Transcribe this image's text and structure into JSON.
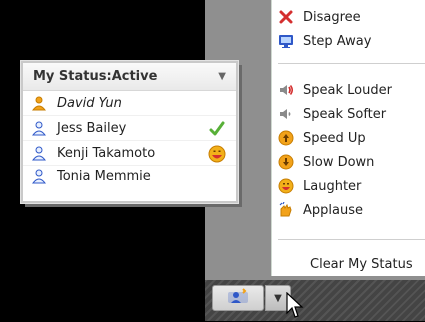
{
  "status_menu": {
    "items": [
      {
        "label": "Disagree",
        "icon": "disagree-icon"
      },
      {
        "label": "Step Away",
        "icon": "step-away-icon"
      },
      {
        "label": "Speak Louder",
        "icon": "speaker-louder-icon"
      },
      {
        "label": "Speak Softer",
        "icon": "speaker-softer-icon"
      },
      {
        "label": "Speed Up",
        "icon": "speed-up-icon"
      },
      {
        "label": "Slow Down",
        "icon": "slow-down-icon"
      },
      {
        "label": "Laughter",
        "icon": "laughter-icon"
      },
      {
        "label": "Applause",
        "icon": "applause-icon"
      },
      {
        "label": "Clear My Status",
        "icon": ""
      }
    ]
  },
  "my_status_panel": {
    "title": "My Status:Active",
    "users": [
      {
        "name": "David Yun",
        "status_icon": ""
      },
      {
        "name": "Jess Bailey",
        "status_icon": "checkmark-icon"
      },
      {
        "name": "Kenji Takamoto",
        "status_icon": "laughter-icon"
      },
      {
        "name": "Tonia Memmie",
        "status_icon": ""
      }
    ]
  },
  "colors": {
    "background": "#000000",
    "panel_border": "#c9c9c9",
    "menu_bg": "#ffffff",
    "text": "#222222",
    "accent_orange": "#f2a21a",
    "icon_blue": "#2f58c8"
  }
}
